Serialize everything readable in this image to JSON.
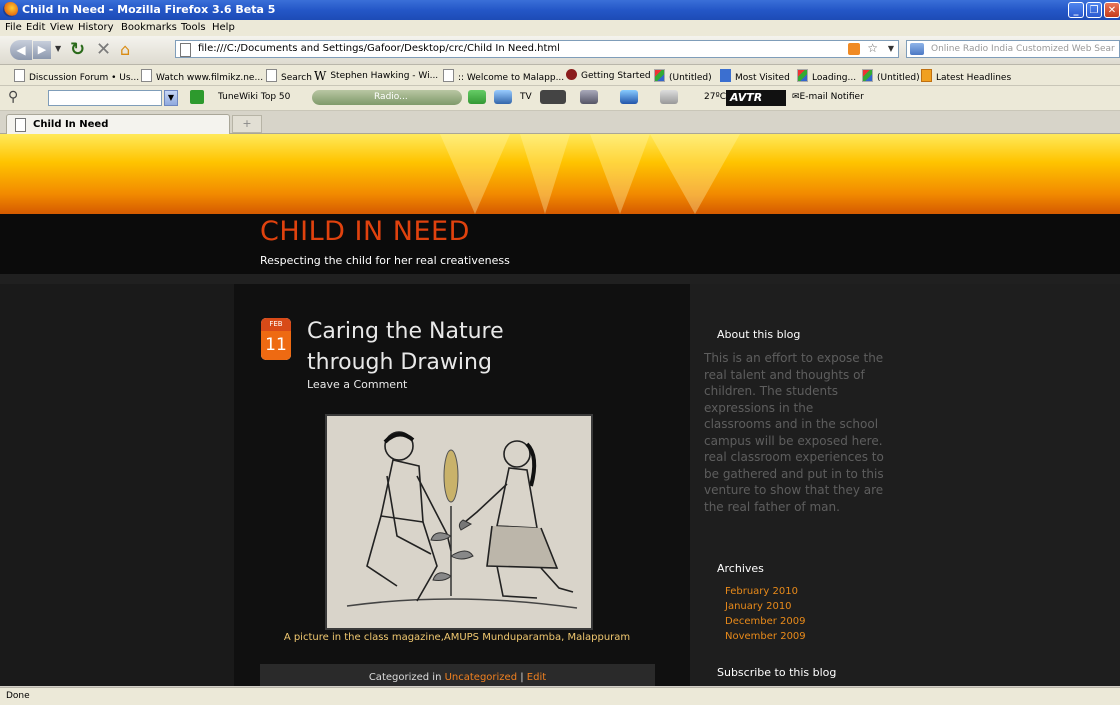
{
  "window": {
    "title": "Child In Need - Mozilla Firefox 3.6 Beta 5"
  },
  "menu": [
    "File",
    "Edit",
    "View",
    "History",
    "Bookmarks",
    "Tools",
    "Help"
  ],
  "nav": {
    "url": "file:///C:/Documents and Settings/Gafoor/Desktop/crc/Child In Need.html",
    "search_placeholder": "Online Radio India Customized Web Sear"
  },
  "bookmarks": [
    "Discussion Forum • Us...",
    "Watch www.filmikz.ne...",
    "Search",
    "Stephen Hawking - Wi...",
    ":: Welcome to Malapp...",
    "Getting Started",
    "(Untitled)",
    "Most Visited",
    "Loading...",
    "(Untitled)",
    "Latest Headlines"
  ],
  "toolbar": {
    "tunewiki": "TuneWiki Top 50",
    "radio": "Radio...",
    "tv": "TV",
    "temp": "27ºC",
    "avtr": "AVTR",
    "email": "E-mail Notifier"
  },
  "tab": {
    "label": "Child In Need",
    "new_tab": "+"
  },
  "blog": {
    "title": "CHILD IN NEED",
    "tagline": "Respecting the child for her real creativeness",
    "post": {
      "month": "FEB",
      "day": "11",
      "title": "Caring the Nature through Drawing",
      "comment": "Leave a Comment",
      "caption": "A picture in the class magazine,AMUPS Munduparamba, Malappuram",
      "categorized_prefix": "Categorized in ",
      "category": "Uncategorized",
      "separator": " | ",
      "edit": "Edit"
    },
    "sidebar": {
      "about_heading": "About this blog",
      "about_text": "This is an effort to expose the real talent and thoughts of children. The students expressions in the classrooms and in the school campus will be exposed here. real classroom experiences to be gathered and put in to this venture to show that they are the real father of man.",
      "archives_heading": "Archives",
      "archives": [
        "February 2010",
        "January 2010",
        "December 2009",
        "November 2009"
      ],
      "subscribe_heading": "Subscribe to this blog"
    }
  },
  "status": "Done"
}
